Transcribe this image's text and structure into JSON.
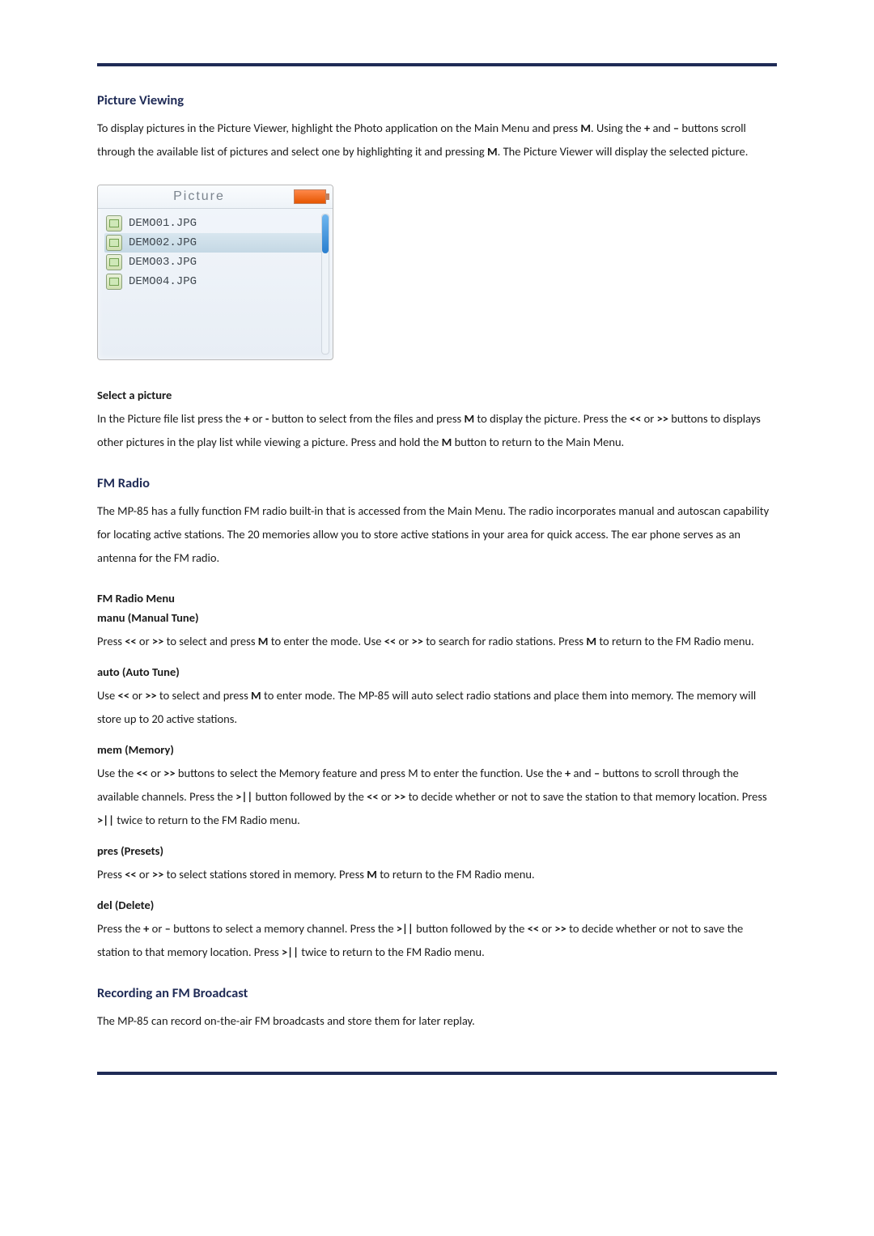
{
  "sections": {
    "pv": {
      "heading": "Picture Viewing",
      "p1a": "To display pictures in the Picture Viewer, highlight the Photo application on the Main Menu and press ",
      "p1b": ".    Using the ",
      "p1c": " and ",
      "p1d": " buttons scroll through the available list of pictures and select one by highlighting it and pressing ",
      "p1e": ". The Picture Viewer will display the selected picture."
    },
    "figure": {
      "title": "Picture",
      "files": [
        "DEMO01.JPG",
        "DEMO02.JPG",
        "DEMO03.JPG",
        "DEMO04.JPG"
      ]
    },
    "sel": {
      "heading": "Select a picture",
      "p1a": "In the Picture file list press the ",
      "p1b": " or ",
      "p1c": " button to select from the files and press ",
      "p1d": " to display the picture.    Press the ",
      "p1e": " or ",
      "p1f": " buttons to displays other pictures in the play list while viewing a picture.    Press and hold the ",
      "p1g": " button to return to the Main Menu."
    },
    "fm": {
      "heading": "FM Radio",
      "p1": "The MP-85 has a fully function FM radio built-in that is accessed from the Main Menu.    The radio incorporates manual and autoscan capability for locating active stations.    The 20 memories allow you to store active stations in your area for quick access.    The ear phone serves as an antenna for the FM radio."
    },
    "fmmenu": {
      "heading": "FM Radio Menu",
      "manu": {
        "h": "manu    (Manual Tune)",
        "pa": "Press ",
        "pb": " or ",
        "pc": " to select and press ",
        "pd": " to enter the mode.    Use ",
        "pe": " or ",
        "pf": " to search for radio stations.    Press ",
        "pg": " to return to the FM Radio menu."
      },
      "auto": {
        "h": "auto    (Auto Tune)",
        "pa": "Use ",
        "pb": " or ",
        "pc": " to select and press ",
        "pd": " to enter mode.    The MP-85 will auto select radio stations and place them into memory.    The memory will store up to 20 active stations."
      },
      "mem": {
        "h": "mem    (Memory)",
        "pa": "Use the ",
        "pb": " or ",
        "pc": " buttons to select the Memory feature and press M to enter the function. Use the ",
        "pd": " and ",
        "pe": " buttons to scroll through the available channels.    Press the ",
        "pf": " button followed by the ",
        "pg": " or ",
        "ph": " to decide whether or not to save the station to that memory location.    Press ",
        "pi": " twice to return to the FM Radio menu."
      },
      "pres": {
        "h": "pres    (Presets)",
        "pa": "Press ",
        "pb": " or ",
        "pc": " to select stations stored in memory.    Press ",
        "pd": " to return to the FM Radio menu."
      },
      "del": {
        "h": "del    (Delete)",
        "pa": "Press the ",
        "pb": " or ",
        "pc": " buttons to select a memory channel.    Press the ",
        "pd": " button followed by the ",
        "pe": " or ",
        "pf": " to decide whether or not to save the station to that memory location.    Press ",
        "pg": " twice to return to the FM Radio menu."
      }
    },
    "rec": {
      "heading": "Recording an FM Broadcast",
      "p1": "The MP-85 can record on-the-air FM broadcasts and store them for later replay."
    }
  },
  "keys": {
    "M": "M",
    "plus": "+",
    "minus": "–",
    "minus2": "-",
    "ll": "<<",
    "rr": ">>",
    "playpause": ">||"
  }
}
